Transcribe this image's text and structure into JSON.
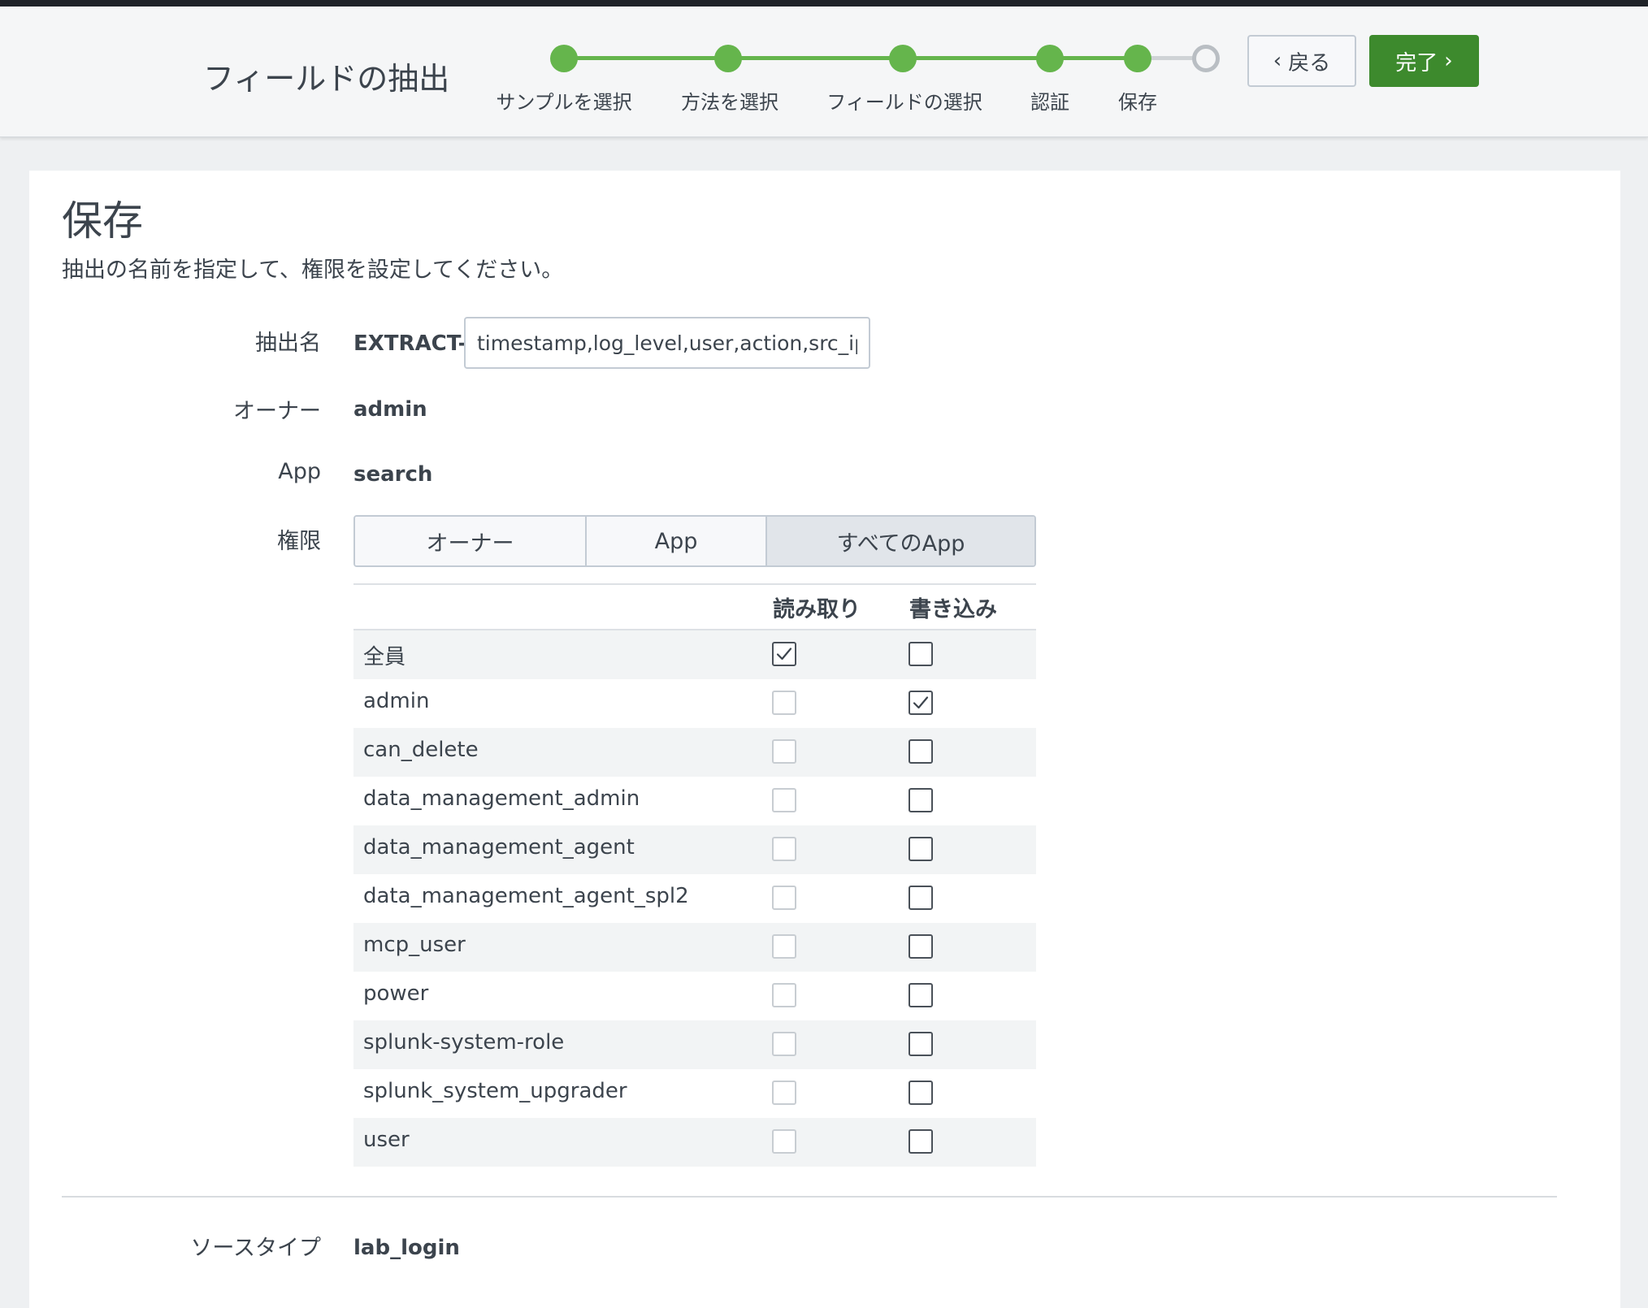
{
  "header": {
    "title": "フィールドの抽出",
    "steps": [
      {
        "label": "サンプルを選択",
        "status": "done"
      },
      {
        "label": "方法を選択",
        "status": "done"
      },
      {
        "label": "フィールドの選択",
        "status": "done"
      },
      {
        "label": "認証",
        "status": "done"
      },
      {
        "label": "保存",
        "status": "current"
      },
      {
        "label": "",
        "status": "pending"
      }
    ],
    "back_label": "戻る",
    "finish_label": "完了"
  },
  "page": {
    "title": "保存",
    "description": "抽出の名前を指定して、権限を設定してください。"
  },
  "form": {
    "extract_name_label": "抽出名",
    "extract_prefix": "EXTRACT-",
    "extract_name_value": "timestamp,log_level,user,action,src_ip",
    "owner_label": "オーナー",
    "owner_value": "admin",
    "app_label": "App",
    "app_value": "search",
    "permissions_label": "権限",
    "permission_options": [
      "オーナー",
      "App",
      "すべてのApp"
    ],
    "permission_selected": "すべてのApp",
    "sourcetype_label": "ソースタイプ",
    "sourcetype_value": "lab_login"
  },
  "permissions_table": {
    "read_header": "読み取り",
    "write_header": "書き込み",
    "rows": [
      {
        "role": "全員",
        "read": true,
        "write": false
      },
      {
        "role": "admin",
        "read": false,
        "write": true
      },
      {
        "role": "can_delete",
        "read": false,
        "write": false
      },
      {
        "role": "data_management_admin",
        "read": false,
        "write": false
      },
      {
        "role": "data_management_agent",
        "read": false,
        "write": false
      },
      {
        "role": "data_management_agent_spl2",
        "read": false,
        "write": false
      },
      {
        "role": "mcp_user",
        "read": false,
        "write": false
      },
      {
        "role": "power",
        "read": false,
        "write": false
      },
      {
        "role": "splunk-system-role",
        "read": false,
        "write": false
      },
      {
        "role": "splunk_system_upgrader",
        "read": false,
        "write": false
      },
      {
        "role": "user",
        "read": false,
        "write": false
      }
    ]
  },
  "colors": {
    "step_done": "#65b54c",
    "finish_button": "#3d8a2d",
    "text": "#3c444d"
  }
}
